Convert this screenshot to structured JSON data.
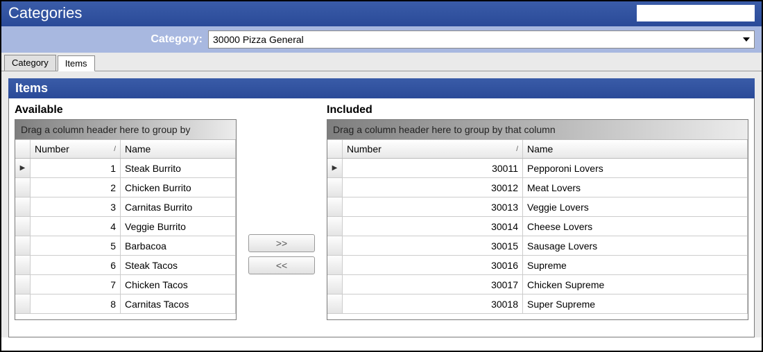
{
  "header": {
    "title": "Categories"
  },
  "categoryBar": {
    "label": "Category:",
    "selected": "30000 Pizza General"
  },
  "tabs": [
    {
      "label": "Category",
      "active": false
    },
    {
      "label": "Items",
      "active": true
    }
  ],
  "panel": {
    "title": "Items"
  },
  "buttons": {
    "addAll": ">>",
    "removeAll": "<<"
  },
  "available": {
    "title": "Available",
    "groupHint": "Drag a column header here to group by",
    "columns": {
      "number": "Number",
      "name": "Name"
    },
    "rows": [
      {
        "number": 1,
        "name": "Steak Burrito",
        "active": true
      },
      {
        "number": 2,
        "name": "Chicken Burrito"
      },
      {
        "number": 3,
        "name": "Carnitas Burrito"
      },
      {
        "number": 4,
        "name": "Veggie Burrito"
      },
      {
        "number": 5,
        "name": "Barbacoa"
      },
      {
        "number": 6,
        "name": "Steak Tacos"
      },
      {
        "number": 7,
        "name": "Chicken Tacos"
      },
      {
        "number": 8,
        "name": "Carnitas Tacos"
      }
    ]
  },
  "included": {
    "title": "Included",
    "groupHint": "Drag a column header here to group by that column",
    "columns": {
      "number": "Number",
      "name": "Name"
    },
    "rows": [
      {
        "number": 30011,
        "name": "Pepporoni Lovers",
        "active": true
      },
      {
        "number": 30012,
        "name": "Meat Lovers"
      },
      {
        "number": 30013,
        "name": "Veggie Lovers"
      },
      {
        "number": 30014,
        "name": "Cheese Lovers"
      },
      {
        "number": 30015,
        "name": "Sausage Lovers"
      },
      {
        "number": 30016,
        "name": "Supreme"
      },
      {
        "number": 30017,
        "name": "Chicken Supreme"
      },
      {
        "number": 30018,
        "name": "Super Supreme"
      }
    ]
  }
}
